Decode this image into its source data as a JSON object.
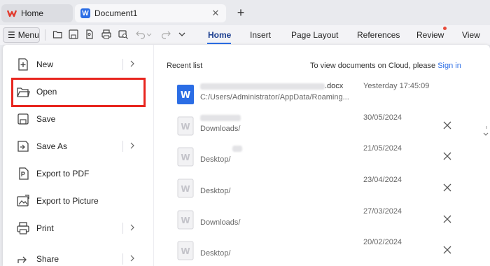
{
  "tabs": {
    "home_label": "Home",
    "doc_label": "Document1"
  },
  "toolbar": {
    "menu_label": "Menu",
    "ribbon_tabs": [
      "Home",
      "Insert",
      "Page Layout",
      "References",
      "Review",
      "View"
    ]
  },
  "menu": {
    "items": [
      {
        "label": "New",
        "icon": "new-document-icon",
        "has_submenu": true
      },
      {
        "label": "Open",
        "icon": "folder-open-icon",
        "has_submenu": false
      },
      {
        "label": "Save",
        "icon": "save-icon",
        "has_submenu": false
      },
      {
        "label": "Save As",
        "icon": "save-as-icon",
        "has_submenu": true
      },
      {
        "label": "Export to PDF",
        "icon": "export-pdf-icon",
        "has_submenu": false
      },
      {
        "label": "Export to Picture",
        "icon": "export-picture-icon",
        "has_submenu": false
      },
      {
        "label": "Print",
        "icon": "print-icon",
        "has_submenu": true
      },
      {
        "label": "Share",
        "icon": "share-icon",
        "has_submenu": true
      }
    ],
    "highlighted": "Open"
  },
  "recent": {
    "title": "Recent list",
    "cloud_text": "To view documents on Cloud, please ",
    "cloud_link": "Sign in",
    "files": [
      {
        "name_suffix": ".docx",
        "path": "C:/Users/Administrator/AppData/Roaming...",
        "date": "Yesterday 17:45:09",
        "active": true
      },
      {
        "name_suffix": "",
        "path": "Downloads/",
        "date": "30/05/2024",
        "active": false
      },
      {
        "name_suffix": "",
        "path": "Desktop/",
        "date": "21/05/2024",
        "active": false
      },
      {
        "name_suffix": "",
        "path": "Desktop/",
        "date": "23/04/2024",
        "active": false
      },
      {
        "name_suffix": "",
        "path": "Downloads/",
        "date": "27/03/2024",
        "active": false
      },
      {
        "name_suffix": "",
        "path": "Desktop/",
        "date": "20/02/2024",
        "active": false
      }
    ]
  },
  "colors": {
    "accent": "#2b6de5",
    "highlight": "#e8261f",
    "brand_red": "#e23b2e"
  }
}
